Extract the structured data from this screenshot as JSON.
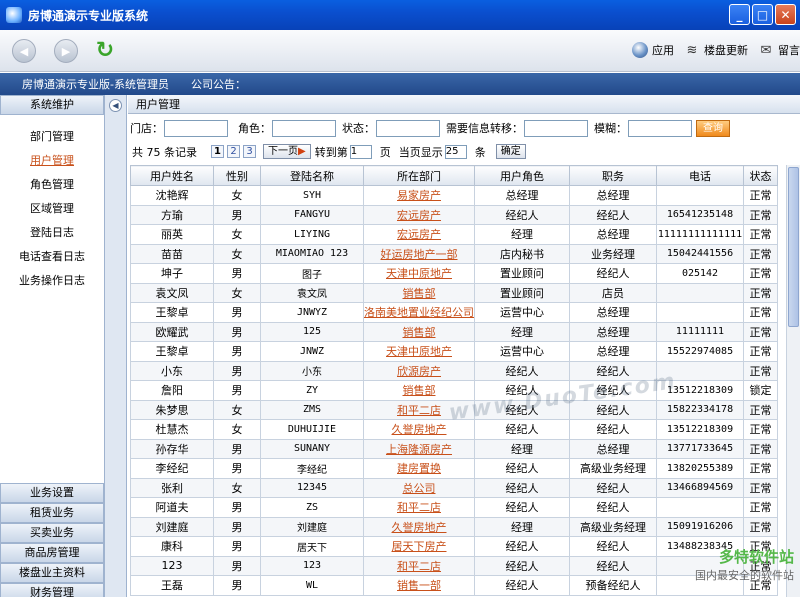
{
  "window": {
    "title": "房博通演示专业版系统"
  },
  "toolbar": {
    "apply_label": "应用",
    "update_label": "楼盘更新",
    "message_label": "留言"
  },
  "header": {
    "system_label": "房博通演示专业版-系统管理员",
    "notice_label": "公司公告："
  },
  "sidebar": {
    "section_title": "系统维护",
    "items": [
      "部门管理",
      "用户管理",
      "角色管理",
      "区域管理",
      "登陆日志",
      "电话查看日志",
      "业务操作日志"
    ],
    "active_item": "用户管理",
    "bottom_sections": [
      "业务设置",
      "租赁业务",
      "买卖业务",
      "商品房管理",
      "楼盘业主资料",
      "财务管理"
    ]
  },
  "main": {
    "title": "用户管理",
    "filters": {
      "store_label": "门店：",
      "role_label": "角色：",
      "status_label": "状态：",
      "transfer_label": "需要信息转移：",
      "fuzzy_label": "模糊：",
      "query_button": "查询"
    },
    "pager": {
      "total_text": "共 75 条记录",
      "pages": [
        "1",
        "2",
        "3"
      ],
      "next_button": "下一页",
      "goto_label": "转到第",
      "goto_value": "1",
      "page_unit": "页",
      "per_page_label": "当页显示",
      "per_page_value": "25",
      "per_page_unit": "条",
      "confirm_button": "确定"
    },
    "table": {
      "columns": [
        "用户姓名",
        "性别",
        "登陆名称",
        "所在部门",
        "用户角色",
        "职务",
        "电话",
        "状态"
      ],
      "rows": [
        [
          "沈艳辉",
          "女",
          "SYH",
          "易家房产",
          "总经理",
          "总经理",
          "",
          "正常"
        ],
        [
          "方瑜",
          "男",
          "FANGYU",
          "宏远房产",
          "经纪人",
          "经纪人",
          "16541235148",
          "正常"
        ],
        [
          "丽英",
          "女",
          "LIYING",
          "宏远房产",
          "经理",
          "总经理",
          "11111111111111",
          "正常"
        ],
        [
          "苗苗",
          "女",
          "MIAOMIAO 123",
          "好运房地产一部",
          "店内秘书",
          "业务经理",
          "15042441556",
          "正常"
        ],
        [
          "坤子",
          "男",
          "图子",
          "天津中原地产",
          "置业顾问",
          "经纪人",
          "025142",
          "正常"
        ],
        [
          "袁文凤",
          "女",
          "袁文凤",
          "销售部",
          "置业顾问",
          "店员",
          "",
          "正常"
        ],
        [
          "王黎卓",
          "男",
          "JNWYZ",
          "洛南美地置业经纪公司",
          "运营中心",
          "总经理",
          "",
          "正常"
        ],
        [
          "欧耀武",
          "男",
          "125",
          "销售部",
          "经理",
          "总经理",
          "11111111",
          "正常"
        ],
        [
          "王黎卓",
          "男",
          "JNWZ",
          "天津中原地产",
          "运营中心",
          "总经理",
          "15522974085",
          "正常"
        ],
        [
          "小东",
          "男",
          "小东",
          "欣源房产",
          "经纪人",
          "经纪人",
          "",
          "正常"
        ],
        [
          "詹阳",
          "男",
          "ZY",
          "销售部",
          "经纪人",
          "经纪人",
          "13512218309",
          "锁定"
        ],
        [
          "朱梦思",
          "女",
          "ZMS",
          "和平二店",
          "经纪人",
          "经纪人",
          "15822334178",
          "正常"
        ],
        [
          "杜慧杰",
          "女",
          "DUHUIJIE",
          "久誉房地产",
          "经纪人",
          "经纪人",
          "13512218309",
          "正常"
        ],
        [
          "孙存华",
          "男",
          "SUNANY",
          "上海隆源房产",
          "经理",
          "总经理",
          "13771733645",
          "正常"
        ],
        [
          "李经纪",
          "男",
          "李经纪",
          "建房置换",
          "经纪人",
          "高级业务经理",
          "13820255389",
          "正常"
        ],
        [
          "张利",
          "女",
          "12345",
          "总公司",
          "经纪人",
          "经纪人",
          "13466894569",
          "正常"
        ],
        [
          "阿道夫",
          "男",
          "ZS",
          "和平二店",
          "经纪人",
          "经纪人",
          "",
          "正常"
        ],
        [
          "刘建庭",
          "男",
          "刘建庭",
          "久誉房地产",
          "经理",
          "高级业务经理",
          "15091916206",
          "正常"
        ],
        [
          "康科",
          "男",
          "居天下",
          "居天下房产",
          "经纪人",
          "经纪人",
          "13488238345",
          "正常"
        ],
        [
          "123",
          "男",
          "123",
          "和平二店",
          "经纪人",
          "经纪人",
          "",
          "正常"
        ],
        [
          "王磊",
          "男",
          "WL",
          "销售一部",
          "经纪人",
          "预备经纪人",
          "",
          "正常"
        ]
      ]
    }
  },
  "watermarks": {
    "center": "www.DuoTe.com",
    "corner_main": "多特软件站",
    "corner_sub": "国内最安全的软件站"
  }
}
